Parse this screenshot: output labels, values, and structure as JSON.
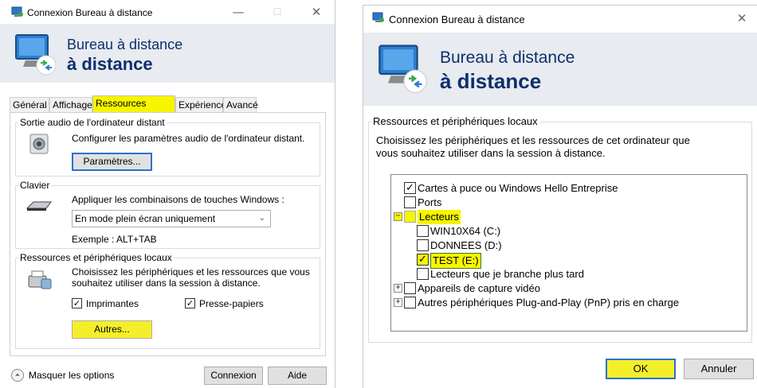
{
  "left_window": {
    "title": "Connexion Bureau à distance",
    "banner": {
      "line1": "Bureau à distance",
      "line2": "à distance"
    },
    "window_buttons": {
      "minimize": "—",
      "maximize": "☐",
      "close": "✕"
    },
    "tabs": [
      {
        "label": "Général"
      },
      {
        "label": "Affichage"
      },
      {
        "label": "Ressources locales"
      },
      {
        "label": "Expérience"
      },
      {
        "label": "Avancé"
      }
    ],
    "audio": {
      "group": "Sortie audio de l'ordinateur distant",
      "desc": "Configurer les paramètres audio de l'ordinateur distant.",
      "button": "Paramètres..."
    },
    "keyboard": {
      "group": "Clavier",
      "desc": "Appliquer les combinaisons de touches Windows :",
      "select_value": "En mode plein écran uniquement",
      "example": "Exemple : ALT+TAB"
    },
    "local": {
      "group": "Ressources et périphériques locaux",
      "desc_line1": "Choisissez les périphériques et les ressources que vous",
      "desc_line2": "souhaitez utiliser dans la session à distance.",
      "printers": "Imprimantes",
      "clipboard": "Presse-papiers",
      "more_button": "Autres..."
    },
    "footer": {
      "hide_options": "Masquer les options",
      "connect": "Connexion",
      "help": "Aide"
    }
  },
  "right_window": {
    "title": "Connexion Bureau à distance",
    "close": "✕",
    "banner": {
      "line1": "Bureau à distance",
      "line2": "à distance"
    },
    "group": "Ressources et périphériques locaux",
    "desc_line1": "Choisissez les périphériques et les ressources de cet ordinateur que",
    "desc_line2": "vous souhaitez utiliser dans la session à distance.",
    "tree": {
      "smartcards": "Cartes à puce ou Windows Hello Entreprise",
      "ports": "Ports",
      "drives": "Lecteurs",
      "drive_c": "WIN10X64 (C:)",
      "drive_d": "DONNEES (D:)",
      "drive_e": "TEST (E:)",
      "drive_later": "Lecteurs que je branche plus tard",
      "video": "Appareils de capture vidéo",
      "pnp": "Autres périphériques Plug-and-Play (PnP) pris en charge"
    },
    "ok": "OK",
    "cancel": "Annuler"
  },
  "glyphs": {
    "check": "✓",
    "expand": "+",
    "collapse": "−",
    "chevron": "⌄",
    "up_arrow": "⏶"
  },
  "colors": {
    "highlight": "#f7f500",
    "banner_text": "#0d2f6e",
    "focus_border": "#2873ce"
  }
}
